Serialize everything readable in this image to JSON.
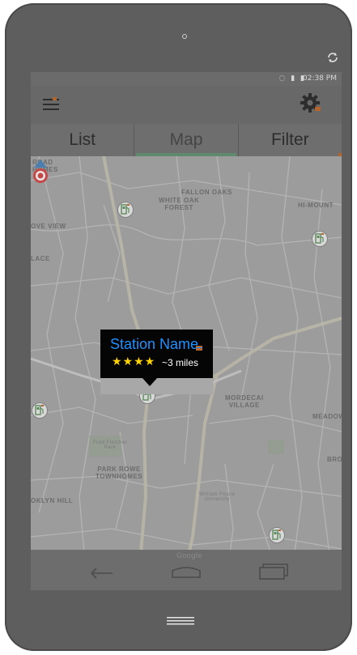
{
  "status": {
    "time": "02:38 PM",
    "icons": "◌ ▮ ▮"
  },
  "appbar": {
    "menu_icon": "menu-icon",
    "settings_icon": "gear-icon"
  },
  "tabs": [
    {
      "label": "List",
      "active": false
    },
    {
      "label": "Map",
      "active": true
    },
    {
      "label": "Filter",
      "active": false
    }
  ],
  "map": {
    "labels": {
      "rhodes": "ROAD\nHOMES",
      "fallon": "FALLON OAKS",
      "white_oak": "WHITE OAK\nFOREST",
      "himount": "HI-MOUNT",
      "groveview": "OVE VIEW",
      "lace": "LACE",
      "mordecai": "MORDECAI\nVILLAGE",
      "meadow": "MEADOW",
      "park_rowe": "PARK ROWE\nTOWNHOMES",
      "brooklyn": "OKLYN HILL",
      "bro": "BRO",
      "fred_fletcher": "Fred Fletcher\nPark",
      "william_peace": "William Peace\nUniversity",
      "google": "Google"
    }
  },
  "popup": {
    "station_name": "Station Name",
    "stars": "★★★★",
    "rating": 4,
    "distance": "~3 miles"
  },
  "colors": {
    "accent_blue": "#1e90ff",
    "star_yellow": "#ffd400",
    "tab_indicator": "#5f8a6e"
  }
}
